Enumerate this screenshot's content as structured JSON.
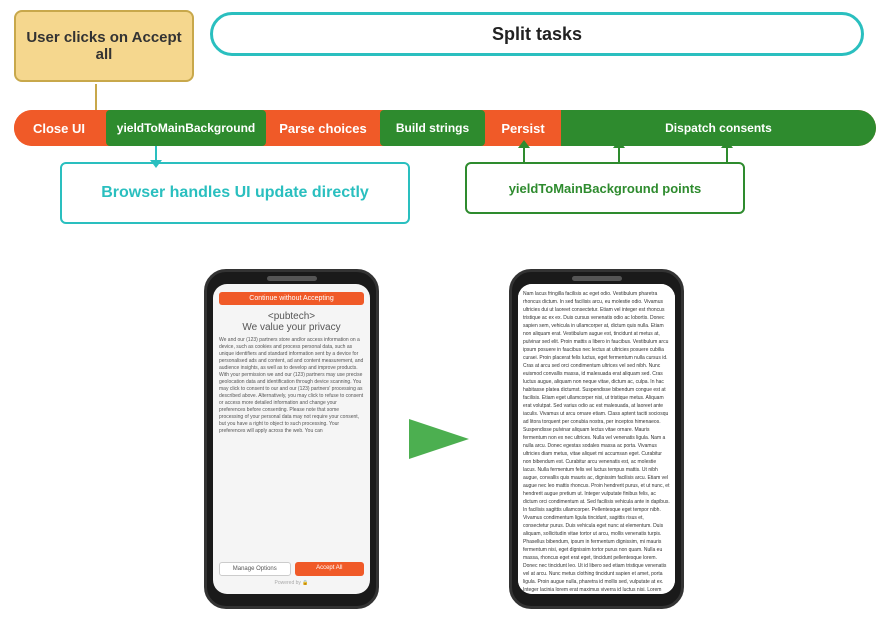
{
  "diagram": {
    "user_clicks_label": "User clicks on\nAccept all",
    "split_tasks_label": "Split tasks",
    "pipeline": {
      "close_ui": "Close UI",
      "yield1": "yieldToMainBackground",
      "parse": "Parse choices",
      "build": "Build strings",
      "persist": "Persist",
      "dispatch": "Dispatch consents"
    },
    "browser_handles_label": "Browser handles UI update directly",
    "yield_points_label": "yieldToMainBackground  points"
  },
  "left_phone": {
    "header": "Continue without Accepting",
    "logo": "<pubtech>",
    "tagline": "We value your privacy",
    "body_text": "We and our (123) partners store and/or access information on a device, such as cookies and process personal data, such as unique identifiers and standard information sent by a device for personalised ads and content, ad and content measurement, and audience insights, as well as to develop and improve products. With your permission we and our (123) partners may use precise geolocation data and identification through device scanning. You may click to consent to our and our (123) partners' processing as described above. Alternatively, you may click to refuse to consent or access more detailed information and change your preferences before consenting. Please note that some processing of your personal data may not require your consent, but you have a right to object to such processing. Your preferences will apply across the web. You can",
    "manage_btn": "Manage Options",
    "accept_btn": "Accept All",
    "powered": "Powered by 🔒"
  },
  "right_phone": {
    "article_text": "Nam lacus fringilla facilisis ac eget odio. Vestibulum pharetra rhoncus dictum. In sed facilisis arcu, eu molestie odio. Vivamus ultricies dui ut laoreet consectetur. Etiam vel integer est rhoncus tristique ac ex ex. Duis cursus venenatis odio ac lobortis. Donec sapien sem, vehicula in ullamcorper at, dictum quis nulla. Etiam non aliquam erat. Vestibulum augue est, tincidunt at metus at, pulvinar sed elit. Proin mattis a libero in faucibus. Vestibulum arcu ipsum posuere in faucibus nec lectus at ultricies posuere cubilia curaei. Proin placerat felis luctus, eget fermentum nulla cursus id. Cras at arcu sed orci condimentum ultrices vel sed nibh. Nunc euismod convallis massa, id malesuada erat aliquam sed. Cras luctus augue, aliquam non neque vitae, dictum ac, culpa. In hac habitasse platea dictumst. Suspendisse bibendum congue est at facilisis. Etiam eget ullamcorper nisi, ut tristique metus. Aliquam erat volutpat. Sed varius odio ac est malesuada, at laoreet ante iaculis. Vivamus ut arcu ornare etiam. Class aptent taciti sociosqu ad litora torquent per conubia nostra, per inceptos himenaeos. Suspendisse pulvinar aliquam lectus vitae ornare. Mauris fermentum non ex nec ultrices. Nulla vel venenatis ligula. Nam a nulla arcu. Donec egestas sodales massa ac porta. Vivamus ultricies diam metus, vitae aliquet mi accumsan eget. Curabitur non bibendum est. Curabitur arcu venenatis est, ac molestie lacus. Nulla fermentum felis vel luctus tempus mattis. Ut nibh augue, convallis quis mauris ac, dignissim facilisis arcu. Etiam vel augue nec leo mattis rhoncus. Proin hendrerit purus, et ut nunc, et hendrerit augue pretium ut. Integer vulputate finibus felis, ac dictum orci condimentum at. Sed facilisis vehicula ante in dapibus. In facilisis sagittis ullamcorper. Pellentesque eget tempor nibh. Vivamus condimentum ligula tincidunt, sagittis risus et, consectetur purus. Duis vehicula eget nunc at elementum. Duis aliquam, sollicitudin vitae tortor ut arcu, mollis venenatis turpis. Phasellus bibendum, ipsum in fermentum dignissim, mi mauris fermentum nisi, eget dignissim tortor purus non quam. Nulla eu massa, rhoncus eget erat eget, tincidunt pellentesque lorem. Donec nec tincidunt leo. Ut id libero sed etiam tristique venenatis vel at arcu. Nunc metus clothing tincidunt sapien et amet, porta ligula. Proin augue nulla, pharetra id mollis sed, vulputate at ex. Integer lacinia lorem erat maximus viverra id luctus nisi. Lorem ipsum dolor sit amet, consectetur adipiscing elit. Aliquam a etiam vel nibh sodales agittis non eleifend felis. Sed id tellus augue."
  },
  "arrow": {
    "color": "#4caf50"
  }
}
